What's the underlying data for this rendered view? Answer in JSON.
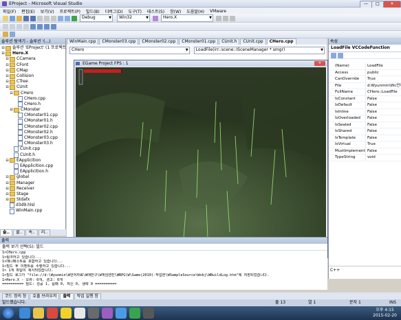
{
  "window": {
    "title": "EProject - Microsoft Visual Studio",
    "minimize": "—",
    "maximize": "□",
    "close": "✕"
  },
  "menu": [
    "파일(F)",
    "편집(E)",
    "보기(V)",
    "프로젝트(P)",
    "빌드(B)",
    "디버그(D)",
    "도구(T)",
    "테스트(S)",
    "창(W)",
    "도움말(H)",
    "VMware"
  ],
  "toolbar": {
    "config": "Debug",
    "platform": "Win32",
    "find": "Hero.X"
  },
  "solution_explorer": {
    "header": "솔루션 탐색기 - 솔루션 '(...)",
    "items": [
      {
        "label": "솔루션 'EProject' (1 프로젝트)",
        "type": "solution",
        "depth": 0
      },
      {
        "label": "Hero.X",
        "type": "project",
        "depth": 0
      },
      {
        "label": "CCamera",
        "type": "folder",
        "depth": 1
      },
      {
        "label": "CFont",
        "type": "folder",
        "depth": 1
      },
      {
        "label": "CMap",
        "type": "folder",
        "depth": 1
      },
      {
        "label": "Collision",
        "type": "folder",
        "depth": 1
      },
      {
        "label": "CTree",
        "type": "folder",
        "depth": 1
      },
      {
        "label": "CUnit",
        "type": "folder",
        "depth": 1
      },
      {
        "label": "CHero",
        "type": "folder",
        "depth": 2
      },
      {
        "label": "CHero.cpp",
        "type": "file",
        "depth": 3
      },
      {
        "label": "CHero.h",
        "type": "file",
        "depth": 3
      },
      {
        "label": "CMonster",
        "type": "folder",
        "depth": 2
      },
      {
        "label": "CMonster01.cpp",
        "type": "file",
        "depth": 3
      },
      {
        "label": "CMonster01.h",
        "type": "file",
        "depth": 3
      },
      {
        "label": "CMonster02.cpp",
        "type": "file",
        "depth": 3
      },
      {
        "label": "CMonster02.h",
        "type": "file",
        "depth": 3
      },
      {
        "label": "CMonster03.cpp",
        "type": "file",
        "depth": 3
      },
      {
        "label": "CMonster03.h",
        "type": "file",
        "depth": 3
      },
      {
        "label": "CUnit.cpp",
        "type": "file",
        "depth": 2
      },
      {
        "label": "CUnit.h",
        "type": "file",
        "depth": 2
      },
      {
        "label": "EApplicition",
        "type": "folder",
        "depth": 1
      },
      {
        "label": "EApplicition.cpp",
        "type": "file",
        "depth": 2
      },
      {
        "label": "EApplicition.h",
        "type": "file",
        "depth": 2
      },
      {
        "label": "global",
        "type": "folder",
        "depth": 1
      },
      {
        "label": "Manager",
        "type": "folder",
        "depth": 1
      },
      {
        "label": "Receiver",
        "type": "folder",
        "depth": 1
      },
      {
        "label": "Stage",
        "type": "folder",
        "depth": 1
      },
      {
        "label": "Stdafx",
        "type": "folder",
        "depth": 1
      },
      {
        "label": "d3d9.hlsl",
        "type": "file",
        "depth": 1
      },
      {
        "label": "WinMain.cpp",
        "type": "file",
        "depth": 1
      }
    ],
    "bottom_tabs": [
      "솔..",
      "클..",
      "속..",
      "리.."
    ]
  },
  "editor": {
    "tabs": [
      "WinMain.cpp",
      "CMonster03.cpp",
      "CMonster02.cpp",
      "CMonster01.cpp",
      "CUnit.h",
      "CUnit.cpp",
      "CHero.cpp"
    ],
    "active_tab": "CHero.cpp",
    "class_combo": "CHero",
    "method_combo": "LoadFile(irr::scene::ISceneManager * smgr)"
  },
  "game_window": {
    "title": "EGame Project FPS : 1"
  },
  "properties": {
    "header": "속성",
    "object": "LoadFile  VCCodeFunction",
    "rows": [
      {
        "k": "(Name)",
        "v": "LoadFile"
      },
      {
        "k": "Access",
        "v": "public"
      },
      {
        "k": "CanOverride",
        "v": "True"
      },
      {
        "k": "File",
        "v": "d:Wyunmin\\Wc언어"
      },
      {
        "k": "FullName",
        "v": "CHero::LoadFile"
      },
      {
        "k": "IsConstant",
        "v": "False"
      },
      {
        "k": "IsDefault",
        "v": "False"
      },
      {
        "k": "IsInline",
        "v": "False"
      },
      {
        "k": "IsOverloaded",
        "v": "False"
      },
      {
        "k": "IsSealed",
        "v": "False"
      },
      {
        "k": "IsShared",
        "v": "False"
      },
      {
        "k": "IsTemplate",
        "v": "False"
      },
      {
        "k": "IsVirtual",
        "v": "True"
      },
      {
        "k": "MustImplement",
        "v": "False"
      },
      {
        "k": "TypeString",
        "v": "void"
      }
    ],
    "footer": "C++"
  },
  "output": {
    "header": "출력",
    "source_label": "출력 보기 선택(S): 빌드",
    "lines": [
      "1>CHero.cpp",
      "1>링크하고 있습니다...",
      "1>매니페스트를 포함하고 있습니다...",
      "1>빌드 후 이벤트를 수행하고 있습니다...",
      "1>        1개 파일이 복사되었습니다.",
      "1>빌드 로그가 \"file://d:\\Wyunmin\\W언어자료\\W에반구\\W게임엔진\\WBPG\\W\\Game(2010)-작업본\\WSampleSource\\Wobj\\WBuildLog.htm\"에 저장되었습니다.",
      "1>Hero.X - 오류: 0개, 경고: 0개",
      "========== 빌드: 성공 1, 실패 0, 최신 0, 생략 0 =========="
    ]
  },
  "bottom_tabs": [
    "코드 정의 창",
    "호출 브라우저",
    "출력",
    "작업 실행 창"
  ],
  "status": {
    "text": "빌드했습니다.",
    "line": "줄 13",
    "col": "열 1",
    "ch": "문자 1",
    "mode": "INS"
  },
  "taskbar": {
    "time": "오후 4:15",
    "date": "2015-02-20"
  }
}
